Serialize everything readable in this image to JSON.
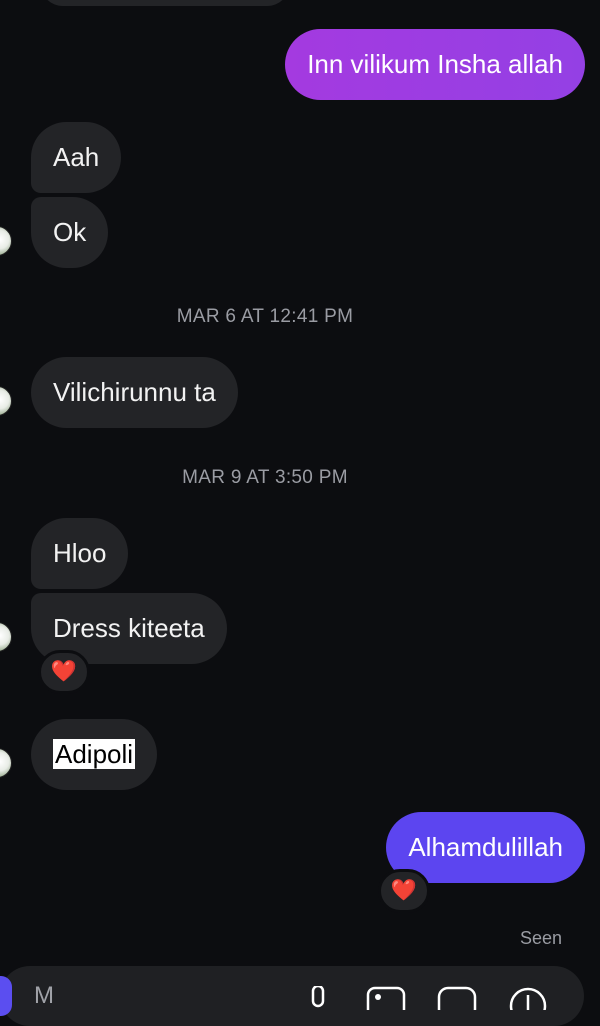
{
  "messages": {
    "out_1": "Inn vilikum Insha allah",
    "in_aah": "Aah",
    "in_ok": "Ok",
    "in_vilichirunnu": "Vilichirunnu ta",
    "in_hloo": "Hloo",
    "in_dress": "Dress kiteeta",
    "in_adipoli": "Adipoli",
    "out_alhamdulillah": "Alhamdulillah"
  },
  "timestamps": {
    "t1": "MAR 6 AT 12:41 PM",
    "t2": "MAR 9 AT 3:50 PM"
  },
  "reactions": {
    "dress": "❤️",
    "alhamdulillah": "❤️"
  },
  "status": {
    "seen": "Seen"
  },
  "composer": {
    "placeholder": "M"
  },
  "colors": {
    "background": "#0c0d10",
    "incoming_bubble": "#232427",
    "outgoing_first": "#9b3de0",
    "outgoing_second": "#5c45f0"
  },
  "icons": {
    "mic": "mic-icon",
    "gallery": "gallery-icon",
    "sticker": "sticker-icon",
    "add": "add-icon"
  }
}
